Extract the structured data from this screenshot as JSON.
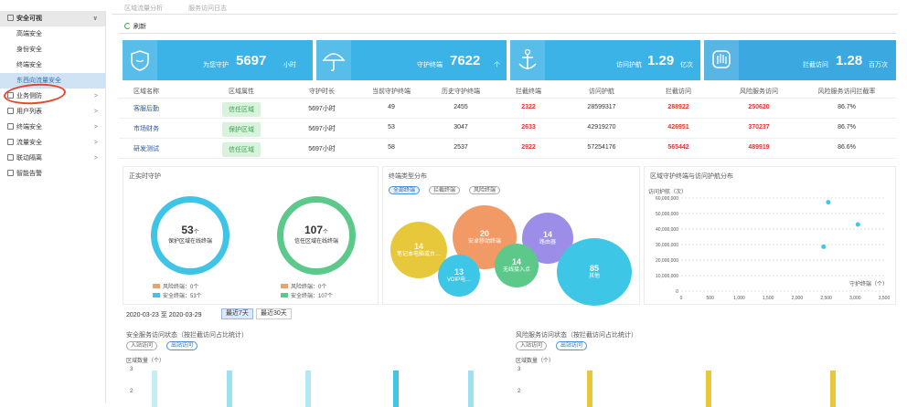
{
  "sidebar": {
    "items": [
      {
        "label": "安全可视",
        "kind": "top",
        "arrow": "∨"
      },
      {
        "label": "高端安全",
        "kind": "sub"
      },
      {
        "label": "身份安全",
        "kind": "sub"
      },
      {
        "label": "终端安全",
        "kind": "sub"
      },
      {
        "label": "东西向流量安全",
        "kind": "sub-active"
      },
      {
        "label": "业务侧防",
        "kind": "top2",
        "arrow": ">"
      },
      {
        "label": "用户列表",
        "kind": "top2",
        "arrow": ">"
      },
      {
        "label": "终端安全",
        "kind": "top2",
        "arrow": ">"
      },
      {
        "label": "流量安全",
        "kind": "top2",
        "arrow": ">"
      },
      {
        "label": "联动隔离",
        "kind": "top2",
        "arrow": ">"
      },
      {
        "label": "智能告警",
        "kind": "top2",
        "arrow": ""
      }
    ]
  },
  "tabs": [
    "区域流量分析",
    "服务访问日志"
  ],
  "toolbar": {
    "refresh": "刷新"
  },
  "cards": [
    {
      "label": "为您守护",
      "value": "5697",
      "unit": "小时",
      "color": "#3bb3e6",
      "icon": "shield-icon"
    },
    {
      "label": "守护终端",
      "value": "7622",
      "unit": "个",
      "color": "#3bb3e6",
      "icon": "umbrella-icon"
    },
    {
      "label": "访问护航",
      "value": "1.29",
      "unit": "亿次",
      "color": "#3bb3e6",
      "icon": "anchor-icon"
    },
    {
      "label": "拦截访问",
      "value": "1.28",
      "unit": "百万次",
      "color": "#3ba9e0",
      "icon": "hand-stop-icon"
    }
  ],
  "table": {
    "headers": [
      "区域名称",
      "区域属性",
      "守护时长",
      "当前守护终端",
      "历史守护终端",
      "拦截终端",
      "访问护航",
      "拦截访问",
      "风险服务访问",
      "风险服务访问拦截率"
    ],
    "rows": [
      [
        "客服后勤",
        "信任区域",
        "5697小时",
        "49",
        "2455",
        "2322",
        "28599317",
        "288922",
        "250620",
        "86.7%"
      ],
      [
        "市场财务",
        "保护区域",
        "5697小时",
        "53",
        "3047",
        "2633",
        "42919270",
        "426951",
        "370237",
        "86.7%"
      ],
      [
        "研发测试",
        "信任区域",
        "5697小时",
        "58",
        "2537",
        "2922",
        "57254176",
        "565442",
        "489919",
        "86.6%"
      ]
    ]
  },
  "protect_panel": {
    "title": "正实时守护",
    "rings": [
      {
        "value": "53",
        "unit": "个",
        "label": "保护区域在线终端",
        "color": "#3ec4e6",
        "legend": [
          {
            "label": "风险终端：0个",
            "color": "#f0a070"
          },
          {
            "label": "安全终端：53个",
            "color": "#3ec4e6"
          }
        ]
      },
      {
        "value": "107",
        "unit": "个",
        "label": "信任区域在线终端",
        "color": "#5cc98a",
        "legend": [
          {
            "label": "风险终端：0个",
            "color": "#f0a070"
          },
          {
            "label": "安全终端：107个",
            "color": "#5cc98a"
          }
        ]
      }
    ]
  },
  "terminal_panel": {
    "title": "终端类型分布",
    "filters": [
      "全部终端",
      "拦截终端",
      "风险终端"
    ],
    "bubbles": [
      {
        "value": "14",
        "label": "笔记本电脑或台…",
        "color": "#e7c83a"
      },
      {
        "value": "20",
        "label": "安卓移动终端",
        "color": "#f29a66"
      },
      {
        "value": "14",
        "label": "路由器",
        "color": "#9b8de8"
      },
      {
        "value": "85",
        "label": "其他",
        "color": "#3ec6e6"
      },
      {
        "value": "13",
        "label": "VOIP电…",
        "color": "#3ec6e6"
      },
      {
        "value": "14",
        "label": "无线接入点",
        "color": "#5cc98a"
      }
    ]
  },
  "chart_data": {
    "type": "scatter",
    "title": "区域守护终端与访问护航分布",
    "ylabel": "访问护航（次）",
    "xlabel": "守护终端（个）",
    "yticks": [
      "60,000,000",
      "50,000,000",
      "40,000,000",
      "30,000,000",
      "20,000,000",
      "10,000,000",
      "0"
    ],
    "xticks": [
      "0",
      "500",
      "1,000",
      "1,500",
      "2,000",
      "2,500",
      "3,000",
      "3,500"
    ],
    "xlim": [
      0,
      3500
    ],
    "ylim": [
      0,
      60000000
    ],
    "points": [
      {
        "x": 2537,
        "y": 57254176
      },
      {
        "x": 3047,
        "y": 42919270
      },
      {
        "x": 2455,
        "y": 28599317
      }
    ],
    "color": "#3ec6e6"
  },
  "daterange": {
    "text": "2020-03-23 至 2020-03-29",
    "buttons": [
      "最近7天",
      "最近30天"
    ]
  },
  "bottom_left": {
    "title": "安全服务访问状态（按拦截访问占比统计）",
    "tabs": [
      "入站访问",
      "出站访问"
    ],
    "ylabel": "区域数量（个）",
    "yticks": [
      "3",
      "2"
    ]
  },
  "bottom_right": {
    "title": "风险服务访问状态（按拦截访问占比统计）",
    "tabs": [
      "入站访问",
      "出站访问"
    ],
    "ylabel": "区域数量（个）",
    "yticks": [
      "3",
      "2"
    ]
  }
}
